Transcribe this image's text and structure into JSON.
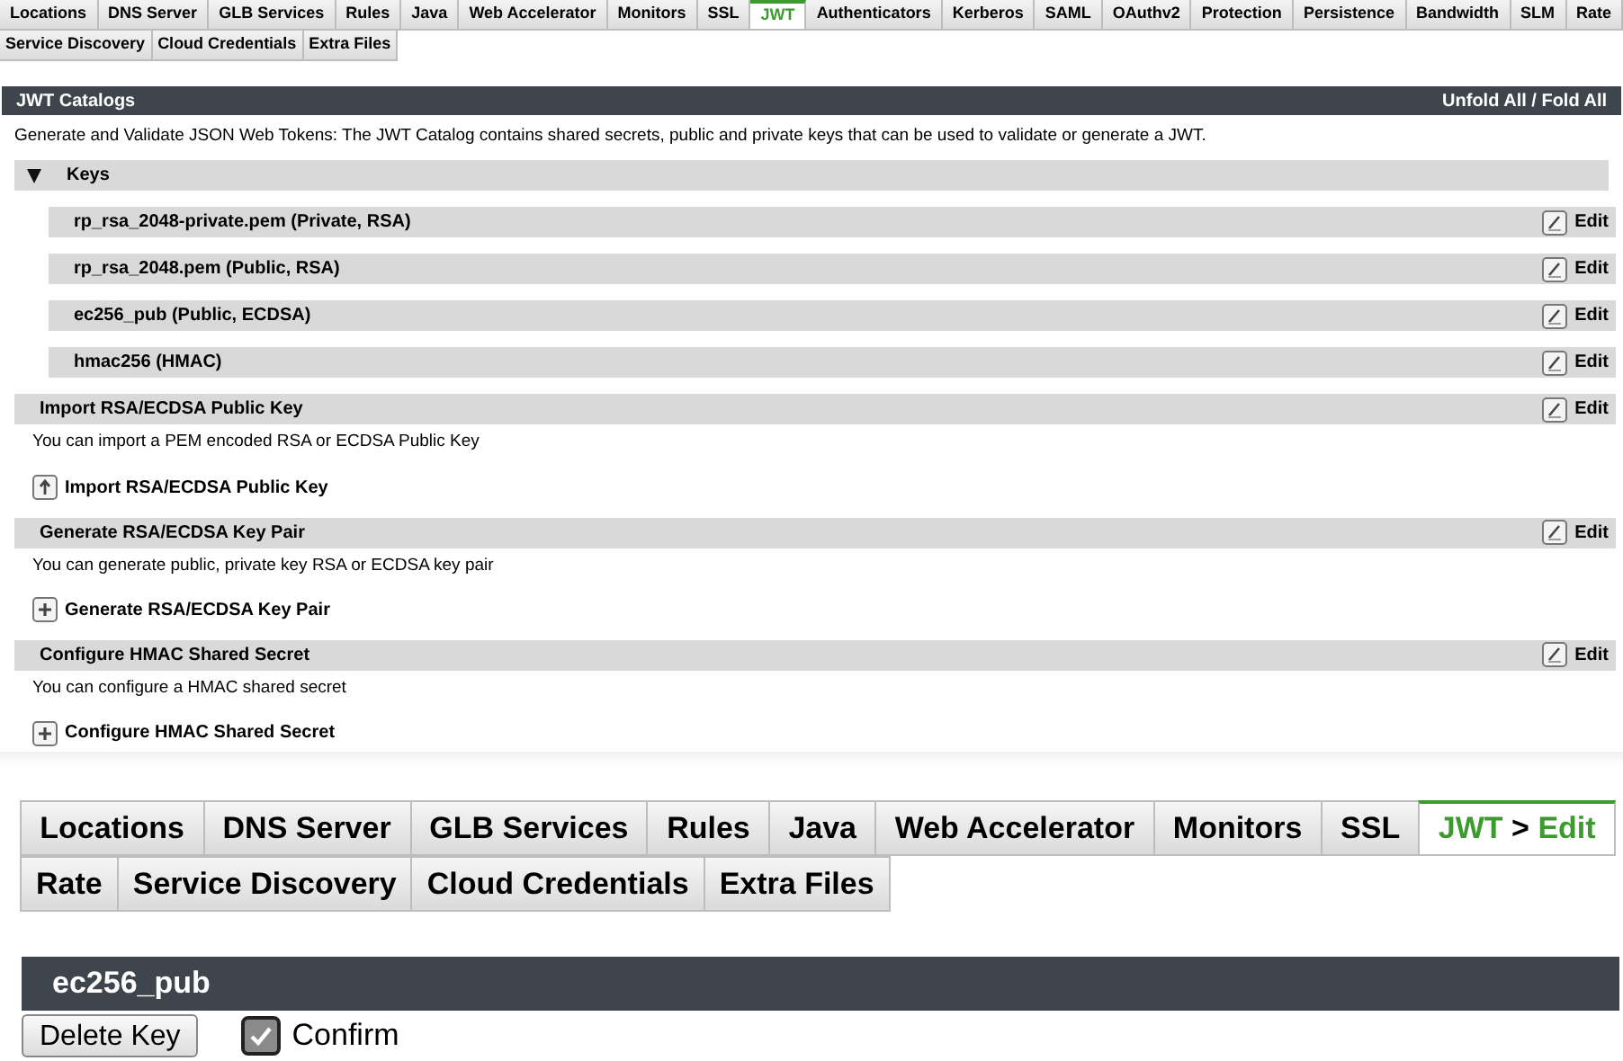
{
  "catalog_view": {
    "tabs": [
      [
        {
          "label": "Locations",
          "selected": false
        },
        {
          "label": "DNS Server",
          "selected": false
        },
        {
          "label": "GLB Services",
          "selected": false
        },
        {
          "label": "Rules",
          "selected": false
        },
        {
          "label": "Java",
          "selected": false
        },
        {
          "label": "Web Accelerator",
          "selected": false
        },
        {
          "label": "Monitors",
          "selected": false
        },
        {
          "label": "SSL",
          "selected": false
        },
        {
          "label": "JWT",
          "selected": true
        },
        {
          "label": "Authenticators",
          "selected": false
        },
        {
          "label": "Kerberos",
          "selected": false
        },
        {
          "label": "SAML",
          "selected": false
        },
        {
          "label": "OAuthv2",
          "selected": false
        },
        {
          "label": "Protection",
          "selected": false
        },
        {
          "label": "Persistence",
          "selected": false
        },
        {
          "label": "Bandwidth",
          "selected": false
        },
        {
          "label": "SLM",
          "selected": false
        },
        {
          "label": "Rate",
          "selected": false
        }
      ],
      [
        {
          "label": "Service Discovery",
          "selected": false
        },
        {
          "label": "Cloud Credentials",
          "selected": false
        },
        {
          "label": "Extra Files",
          "selected": false
        }
      ]
    ],
    "header": {
      "title": "JWT Catalogs",
      "action": "Unfold All / Fold All"
    },
    "description": "Generate and Validate JSON Web Tokens: The JWT Catalog contains shared secrets, public and private keys that can be used to validate or generate a JWT.",
    "keys": {
      "title": "Keys",
      "expanded": true,
      "items": [
        {
          "name": "rp_rsa_2048-private.pem (Private, RSA)",
          "action": "Edit"
        },
        {
          "name": "rp_rsa_2048.pem (Public, RSA)",
          "action": "Edit"
        },
        {
          "name": "ec256_pub (Public, ECDSA)",
          "action": "Edit"
        },
        {
          "name": "hmac256 (HMAC)",
          "action": "Edit"
        }
      ]
    },
    "sections": [
      {
        "title": "Import RSA/ECDSA Public Key",
        "action": "Edit",
        "text": "You can import a PEM encoded RSA or ECDSA Public Key",
        "button": {
          "kind": "upload",
          "label": "Import RSA/ECDSA Public Key"
        }
      },
      {
        "title": "Generate RSA/ECDSA Key Pair",
        "action": "Edit",
        "text": "You can generate public, private key RSA or ECDSA key pair",
        "button": {
          "kind": "add",
          "label": "Generate RSA/ECDSA Key Pair"
        }
      },
      {
        "title": "Configure HMAC Shared Secret",
        "action": "Edit",
        "text": "You can configure a HMAC shared secret",
        "button": {
          "kind": "add",
          "label": "Configure HMAC Shared Secret"
        }
      }
    ]
  },
  "edit_view": {
    "tabs": [
      [
        {
          "label": "Locations",
          "selected": false
        },
        {
          "label": "DNS Server",
          "selected": false
        },
        {
          "label": "GLB Services",
          "selected": false
        },
        {
          "label": "Rules",
          "selected": false
        },
        {
          "label": "Java",
          "selected": false
        },
        {
          "label": "Web Accelerator",
          "selected": false
        },
        {
          "label": "Monitors",
          "selected": false
        },
        {
          "label": "SSL",
          "selected": false
        },
        {
          "label": "JWT",
          "separator": ">",
          "sublabel": "Edit",
          "selected": true
        }
      ],
      [
        {
          "label": "Rate",
          "selected": false
        },
        {
          "label": "Service Discovery",
          "selected": false
        },
        {
          "label": "Cloud Credentials",
          "selected": false
        },
        {
          "label": "Extra Files",
          "selected": false
        }
      ]
    ],
    "header": {
      "title": "ec256_pub"
    },
    "delete_button": "Delete Key",
    "confirm": {
      "label": "Confirm",
      "checked": true
    }
  }
}
